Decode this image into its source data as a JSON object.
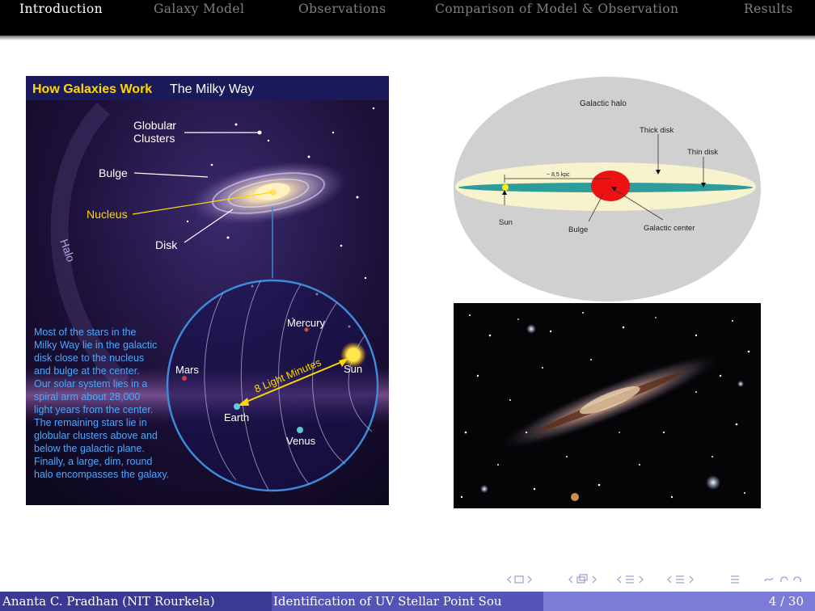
{
  "nav": {
    "items": [
      {
        "label": "Introduction",
        "active": true
      },
      {
        "label": "Galaxy Model",
        "active": false
      },
      {
        "label": "Observations",
        "active": false
      },
      {
        "label": "Comparison of Model & Observation",
        "active": false
      },
      {
        "label": "Results",
        "active": false
      }
    ]
  },
  "milky_way_figure": {
    "title_bold": "How Galaxies Work",
    "title_plain": "The Milky Way",
    "labels": {
      "globular_clusters_1": "Globular",
      "globular_clusters_2": "Clusters",
      "bulge": "Bulge",
      "nucleus": "Nucleus",
      "disk": "Disk",
      "halo": "Halo",
      "mercury": "Mercury",
      "mars": "Mars",
      "sun": "Sun",
      "earth": "Earth",
      "venus": "Venus",
      "light_minutes": "8 Light Minutes"
    },
    "description": [
      "Most of the stars in the",
      "Milky Way lie in the galactic",
      "disk close to the nucleus",
      "and bulge at the center.",
      "Our solar system lies in a",
      "spiral arm about 28,000",
      "light years from the center.",
      "The remaining stars lie in",
      "globular clusters above and",
      "below the galactic plane.",
      "Finally, a large, dim, round",
      "halo encompasses the galaxy."
    ]
  },
  "structure_diagram": {
    "galactic_halo": "Galactic halo",
    "thick_disk": "Thick disk",
    "thin_disk": "Thin disk",
    "distance": "~ 8,5 kpc",
    "sun": "Sun",
    "bulge": "Bulge",
    "galactic_center": "Galactic center"
  },
  "nav_symbols": "◂ ▢ ▸ ◂ ⧉ ▸ ◂ ☰ ▸ ◂ ☰ ▸ ☰ ∽ ↶ ↷",
  "footer": {
    "author": "Ananta C. Pradhan (NIT Rourkela)",
    "title": "Identification of UV Stellar Point Sou",
    "page": "4 / 30"
  }
}
